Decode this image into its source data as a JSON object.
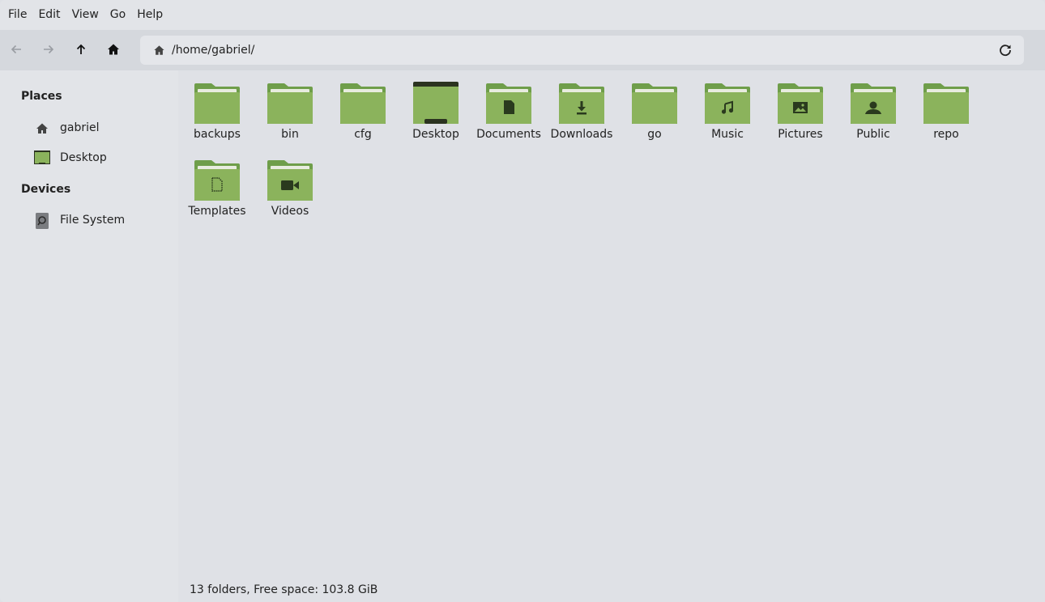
{
  "menubar": {
    "items": [
      "File",
      "Edit",
      "View",
      "Go",
      "Help"
    ]
  },
  "toolbar": {
    "path": "/home/gabriel/"
  },
  "sidebar": {
    "places_header": "Places",
    "places": [
      {
        "label": "gabriel",
        "icon": "home-icon"
      },
      {
        "label": "Desktop",
        "icon": "desktop-icon"
      }
    ],
    "devices_header": "Devices",
    "devices": [
      {
        "label": "File System",
        "icon": "drive-icon"
      }
    ]
  },
  "folders": [
    {
      "name": "backups",
      "emblem": "none"
    },
    {
      "name": "bin",
      "emblem": "none"
    },
    {
      "name": "cfg",
      "emblem": "none"
    },
    {
      "name": "Desktop",
      "emblem": "desktop"
    },
    {
      "name": "Documents",
      "emblem": "document"
    },
    {
      "name": "Downloads",
      "emblem": "download"
    },
    {
      "name": "go",
      "emblem": "none"
    },
    {
      "name": "Music",
      "emblem": "music"
    },
    {
      "name": "Pictures",
      "emblem": "picture"
    },
    {
      "name": "Public",
      "emblem": "person"
    },
    {
      "name": "repo",
      "emblem": "none"
    },
    {
      "name": "Templates",
      "emblem": "template"
    },
    {
      "name": "Videos",
      "emblem": "video"
    }
  ],
  "status": "13 folders, Free space: 103.8 GiB",
  "colors": {
    "folder_back": "#6f9e4a",
    "folder_front": "#8bb35c",
    "folder_paper": "#e8ecdf",
    "emblem": "#2a3a1e"
  }
}
